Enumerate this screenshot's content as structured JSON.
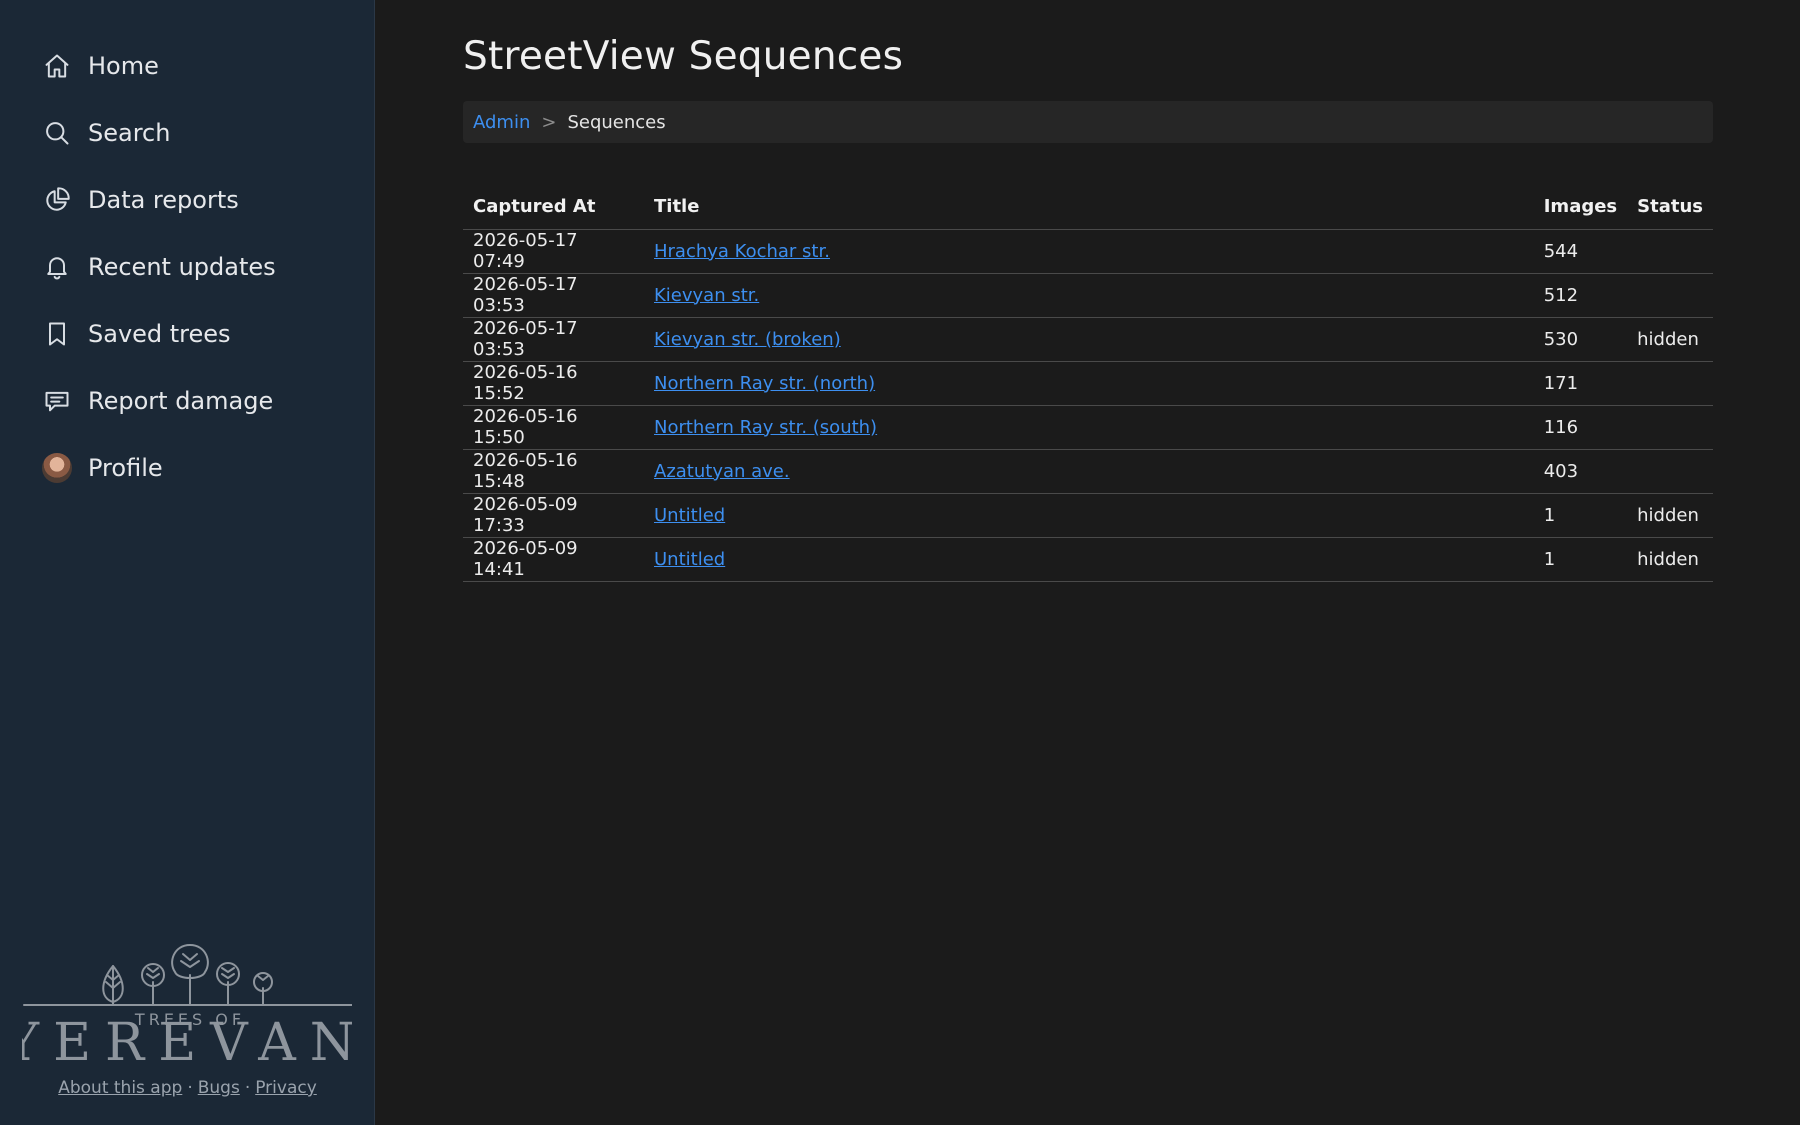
{
  "sidebar": {
    "items": [
      {
        "label": "Home",
        "icon": "home-icon"
      },
      {
        "label": "Search",
        "icon": "search-icon"
      },
      {
        "label": "Data reports",
        "icon": "pie-chart-icon"
      },
      {
        "label": "Recent updates",
        "icon": "bell-icon"
      },
      {
        "label": "Saved trees",
        "icon": "bookmark-icon"
      },
      {
        "label": "Report damage",
        "icon": "message-icon"
      },
      {
        "label": "Profile",
        "icon": "avatar"
      }
    ],
    "logo": {
      "top": "TREES OF",
      "bottom": "YEREVAN"
    },
    "footer": {
      "about": "About this app",
      "bugs": "Bugs",
      "privacy": "Privacy",
      "separator": "·"
    }
  },
  "main": {
    "title": "StreetView Sequences",
    "breadcrumb": {
      "parent": "Admin",
      "separator": ">",
      "current": "Sequences"
    },
    "table": {
      "headers": {
        "captured_at": "Captured At",
        "title": "Title",
        "images": "Images",
        "status": "Status"
      },
      "rows": [
        {
          "captured_at": "2026-05-17 07:49",
          "title": "Hrachya Kochar str.",
          "images": "544",
          "status": ""
        },
        {
          "captured_at": "2026-05-17 03:53",
          "title": "Kievyan str.",
          "images": "512",
          "status": ""
        },
        {
          "captured_at": "2026-05-17 03:53",
          "title": "Kievyan str. (broken)",
          "images": "530",
          "status": "hidden"
        },
        {
          "captured_at": "2026-05-16 15:52",
          "title": "Northern Ray str. (north)",
          "images": "171",
          "status": ""
        },
        {
          "captured_at": "2026-05-16 15:50",
          "title": "Northern Ray str. (south)",
          "images": "116",
          "status": ""
        },
        {
          "captured_at": "2026-05-16 15:48",
          "title": "Azatutyan ave.",
          "images": "403",
          "status": ""
        },
        {
          "captured_at": "2026-05-09 17:33",
          "title": "Untitled",
          "images": "1",
          "status": "hidden"
        },
        {
          "captured_at": "2026-05-09 14:41",
          "title": "Untitled",
          "images": "1",
          "status": "hidden"
        }
      ]
    }
  },
  "colors": {
    "sidebar_bg": "#1b2836",
    "main_bg": "#1b1b1b",
    "link": "#3d8ff0"
  }
}
